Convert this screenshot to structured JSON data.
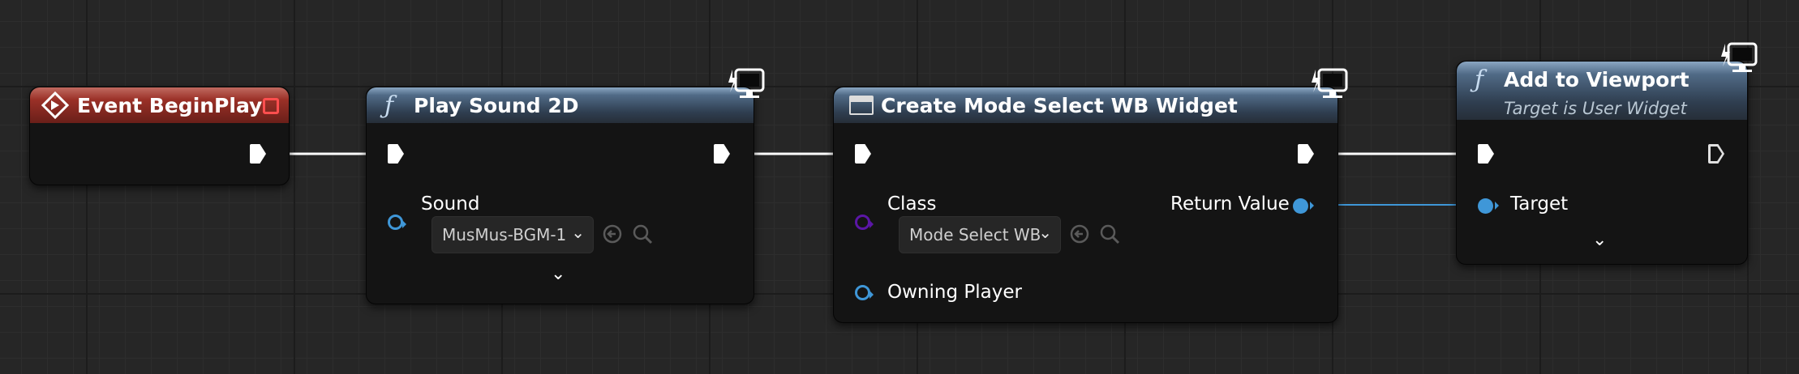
{
  "nodes": {
    "begin_play": {
      "title": "Event BeginPlay"
    },
    "play_sound": {
      "title": "Play Sound 2D",
      "sound_label": "Sound",
      "sound_value": "MusMus-BGM-1"
    },
    "create_widget": {
      "title": "Create Mode Select WB Widget",
      "class_label": "Class",
      "class_value": "Mode Select WB",
      "return_label": "Return Value",
      "owning_label": "Owning Player"
    },
    "add_viewport": {
      "title": "Add to Viewport",
      "subtitle": "Target is User Widget",
      "target_label": "Target"
    }
  },
  "icons": {
    "function": "ƒ",
    "expand": "⌄",
    "chevron": "⌄"
  },
  "colors": {
    "event_header": "#9a3027",
    "function_header": "#506a86",
    "object_pin": "#3f97d8",
    "class_pin": "#5b16a6",
    "exec_wire": "#ffffff",
    "data_wire": "#3f97d8"
  }
}
